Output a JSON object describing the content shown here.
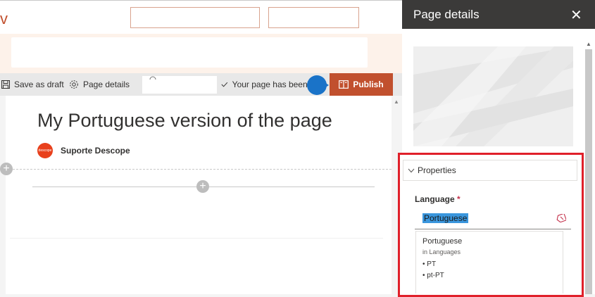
{
  "site": {
    "logo_letter": "v"
  },
  "command_bar": {
    "save_draft": "Save as draft",
    "page_details": "Page details",
    "status": "Your page has been s",
    "publish": "Publish"
  },
  "page": {
    "title": "My Portuguese version of the page",
    "author": "Suporte Descope",
    "avatar_text": "descope",
    "add_glyph": "+"
  },
  "panel": {
    "title": "Page details",
    "close": "✕",
    "properties": {
      "header": "Properties",
      "language_label": "Language",
      "required_mark": "*",
      "language_value": "Portuguese",
      "suggestion_title": "Portuguese",
      "suggestion_sub": "in Languages",
      "suggestion_items": [
        "• PT",
        "• pt-PT"
      ]
    }
  },
  "colors": {
    "accent": "#c1502e",
    "highlight_border": "#e0202a",
    "panel_header": "#3b3a39",
    "coach_dot": "#1a73c8"
  }
}
